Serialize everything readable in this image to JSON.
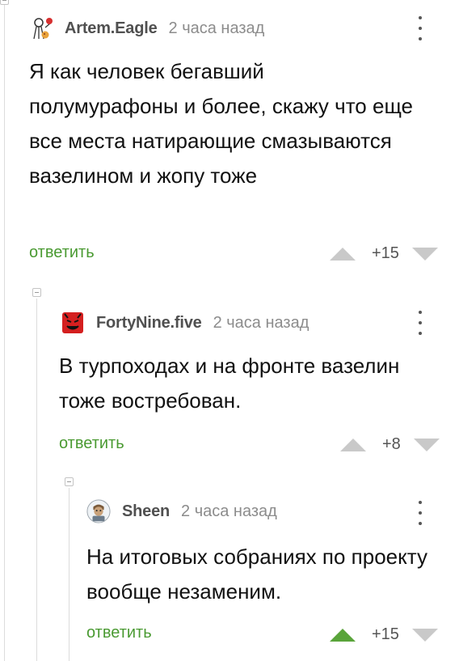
{
  "comments": [
    {
      "username": "Artem.Eagle",
      "time": "2 часа назад",
      "avatar_icon": "balloon-meme-avatar",
      "body": "Я как человек бегавший полумурафоны и более, скажу что еще все места натирающие смазываются вазелином и жопу тоже",
      "reply_label": "ответить",
      "score": "+15",
      "upvoted": false
    },
    {
      "username": "FortyNine.five",
      "time": "2 часа назад",
      "avatar_icon": "red-devil-face-avatar",
      "body": "В турпоходах и на фронте вазелин тоже востребован.",
      "reply_label": "ответить",
      "score": "+8",
      "upvoted": false
    },
    {
      "username": "Sheen",
      "time": "2 часа назад",
      "avatar_icon": "cartoon-character-avatar",
      "body": "На итоговых собраниях по проекту вообще незаменим.",
      "reply_label": "ответить",
      "score": "+15",
      "upvoted": true
    }
  ],
  "colors": {
    "reply": "#4a9a32",
    "upvote_active": "#59a43a",
    "vote_inactive": "#c9c9c9"
  }
}
